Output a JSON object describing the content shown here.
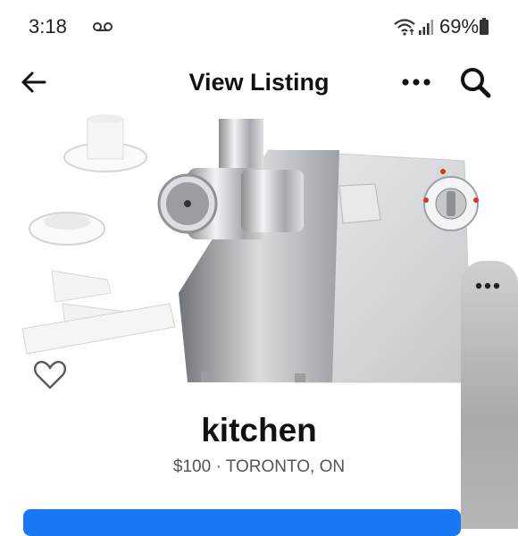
{
  "status_bar": {
    "time": "3:18",
    "battery": "69%"
  },
  "header": {
    "title": "View Listing"
  },
  "listing": {
    "title": "kitchen",
    "price": "$100",
    "separator": "·",
    "location": "TORONTO, ON"
  },
  "icons": {
    "back": "arrow-left-icon",
    "more": "more-horizontal-icon",
    "search": "search-icon",
    "save": "heart-outline-icon",
    "voicemail": "voicemail-icon",
    "wifi": "wifi-icon",
    "signal": "signal-icon",
    "battery": "battery-icon"
  },
  "colors": {
    "accent": "#1877f2",
    "text": "#111111",
    "muted": "#555555"
  }
}
